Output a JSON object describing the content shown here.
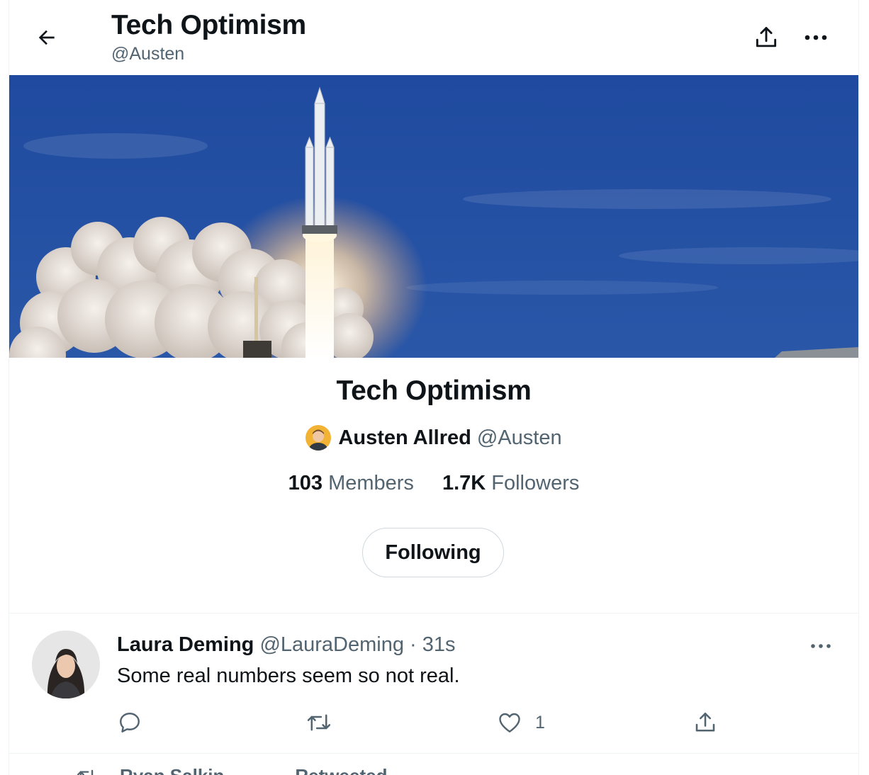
{
  "header": {
    "title": "Tech Optimism",
    "handle": "@Austen",
    "back_icon": "arrow-left-icon",
    "share_icon": "share-icon",
    "more_icon": "more-horizontal-icon"
  },
  "banner": {
    "description_icon": "rocket-launch-image"
  },
  "list": {
    "name": "Tech Optimism",
    "owner_name": "Austen Allred",
    "owner_handle": "@Austen",
    "members_count": "103",
    "members_label": "Members",
    "followers_count": "1.7K",
    "followers_label": "Followers",
    "follow_button_label": "Following"
  },
  "tweet": {
    "author_name": "Laura Deming",
    "author_handle": "@LauraDeming",
    "separator": "·",
    "time": "31s",
    "text": "Some real numbers seem so not real.",
    "reply_count": "",
    "retweet_count": "",
    "like_count": "1"
  },
  "next_item": {
    "retweeter": "Ryan Salkin",
    "retweeted_label": "Retweeted"
  },
  "colors": {
    "text_primary": "#0f1419",
    "text_secondary": "#536471",
    "border": "#eff3f4",
    "sky": "#2a4d9a"
  }
}
